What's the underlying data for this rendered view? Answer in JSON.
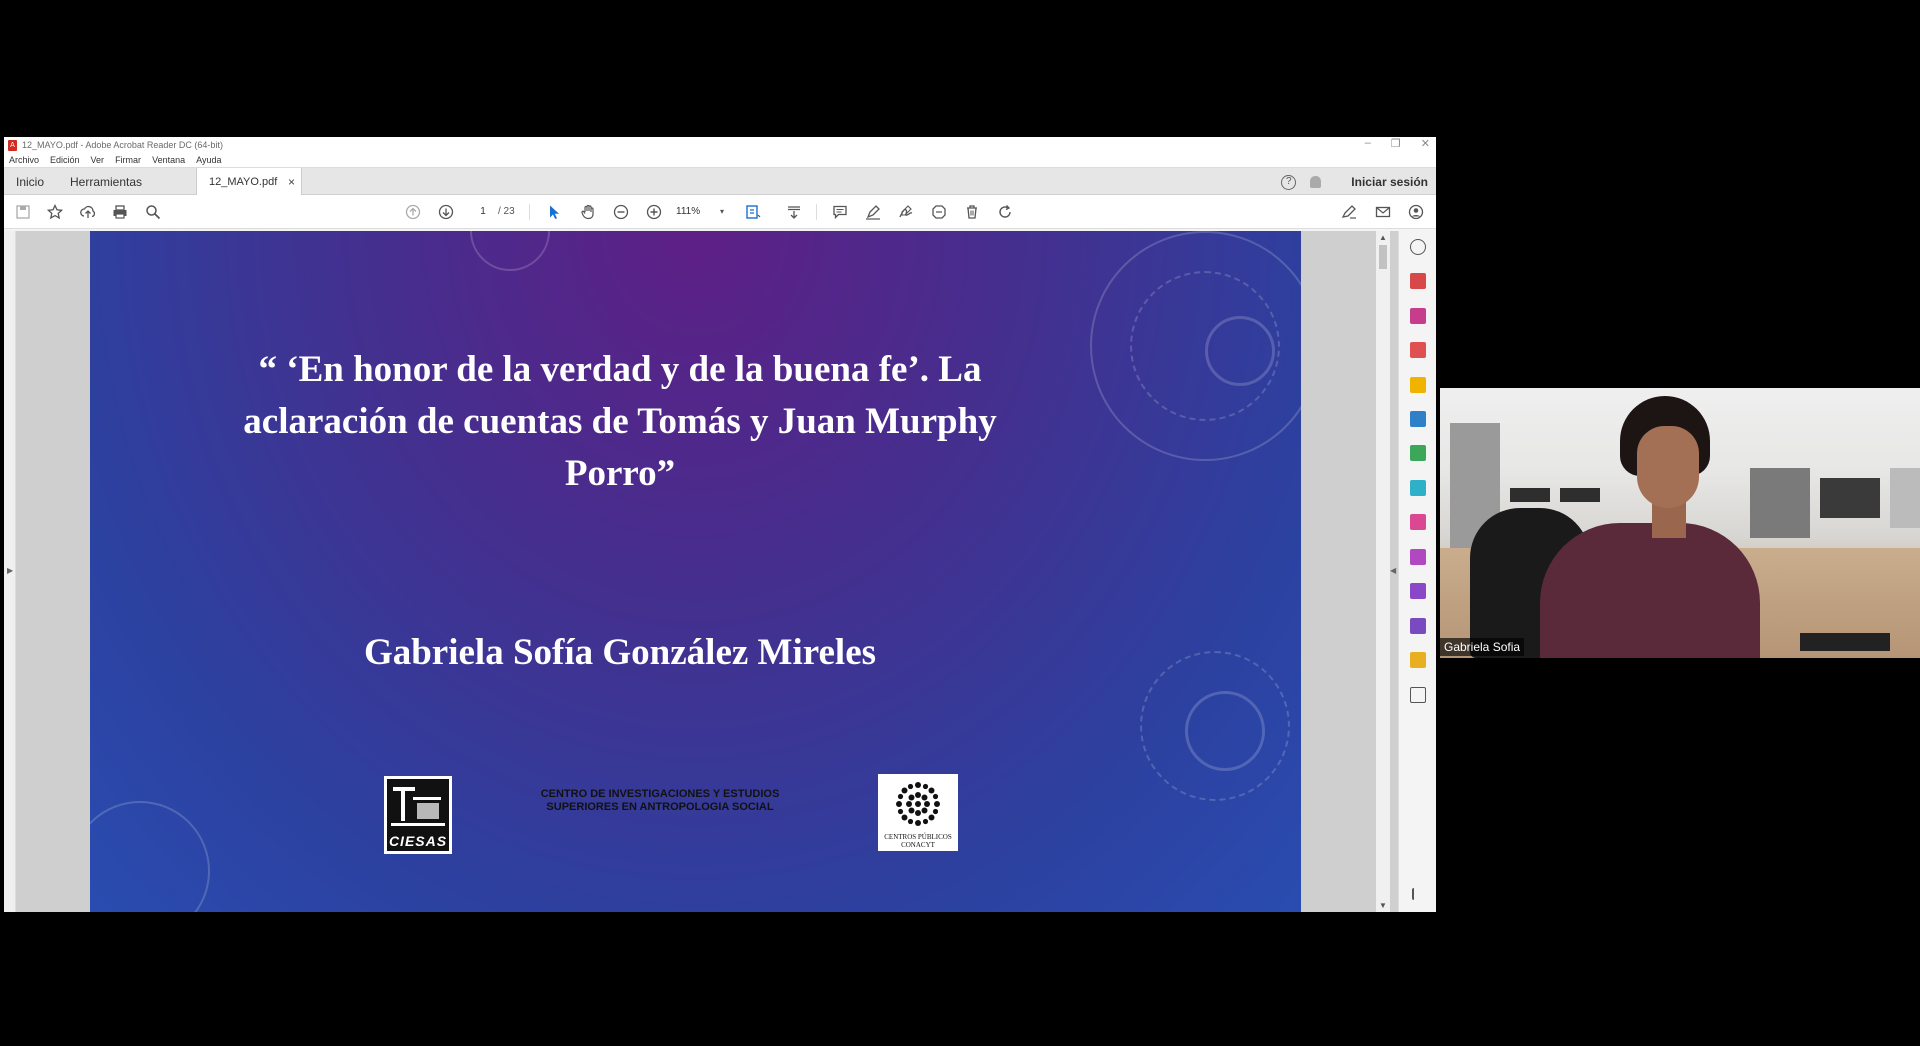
{
  "window": {
    "title": "12_MAYO.pdf - Adobe Acrobat Reader DC (64-bit)",
    "minimize": "–",
    "restore": "❐",
    "close": "✕"
  },
  "menubar": [
    "Archivo",
    "Edición",
    "Ver",
    "Firmar",
    "Ventana",
    "Ayuda"
  ],
  "tabs": {
    "home": "Inicio",
    "tools": "Herramientas",
    "document": "12_MAYO.pdf",
    "close_tab": "×",
    "help": "?",
    "sign_in": "Iniciar sesión"
  },
  "toolbar": {
    "current_page": "1",
    "total_pages": "/ 23",
    "zoom": "111%",
    "zoom_caret": "▾"
  },
  "slide": {
    "title": "“ ‘En honor de la verdad y de la buena fe’. La aclaración de cuentas de Tomás y Juan Murphy Porro”",
    "author": "Gabriela Sofía González Mireles",
    "institution": "CENTRO DE INVESTIGACIONES Y ESTUDIOS SUPERIORES EN ANTROPOLOGIA SOCIAL",
    "logo_left": "CIESAS",
    "logo_right": "CENTROS PÚBLICOS CONACYT"
  },
  "webcam": {
    "participant_name": "Gabriela Sofia"
  },
  "icons": {
    "toolbar_left": [
      "save-icon",
      "star-icon",
      "upload-icon",
      "print-icon",
      "search-icon"
    ],
    "toolbar_nav": [
      "page-up-icon",
      "page-down-icon"
    ],
    "toolbar_tools": [
      "select-cursor-icon",
      "hand-icon",
      "zoom-out-icon",
      "zoom-in-icon",
      "fit-page-icon",
      "scroll-mode-icon",
      "comment-icon",
      "highlight-icon",
      "sign-icon",
      "stamp-icon",
      "delete-icon",
      "rotate-icon"
    ],
    "toolbar_right": [
      "fill-sign-icon",
      "email-icon",
      "account-icon"
    ]
  },
  "colors": {
    "slide_top": "#5e1f86",
    "slide_bottom": "#2a4cb0",
    "acrobat_red": "#d42a1f"
  }
}
